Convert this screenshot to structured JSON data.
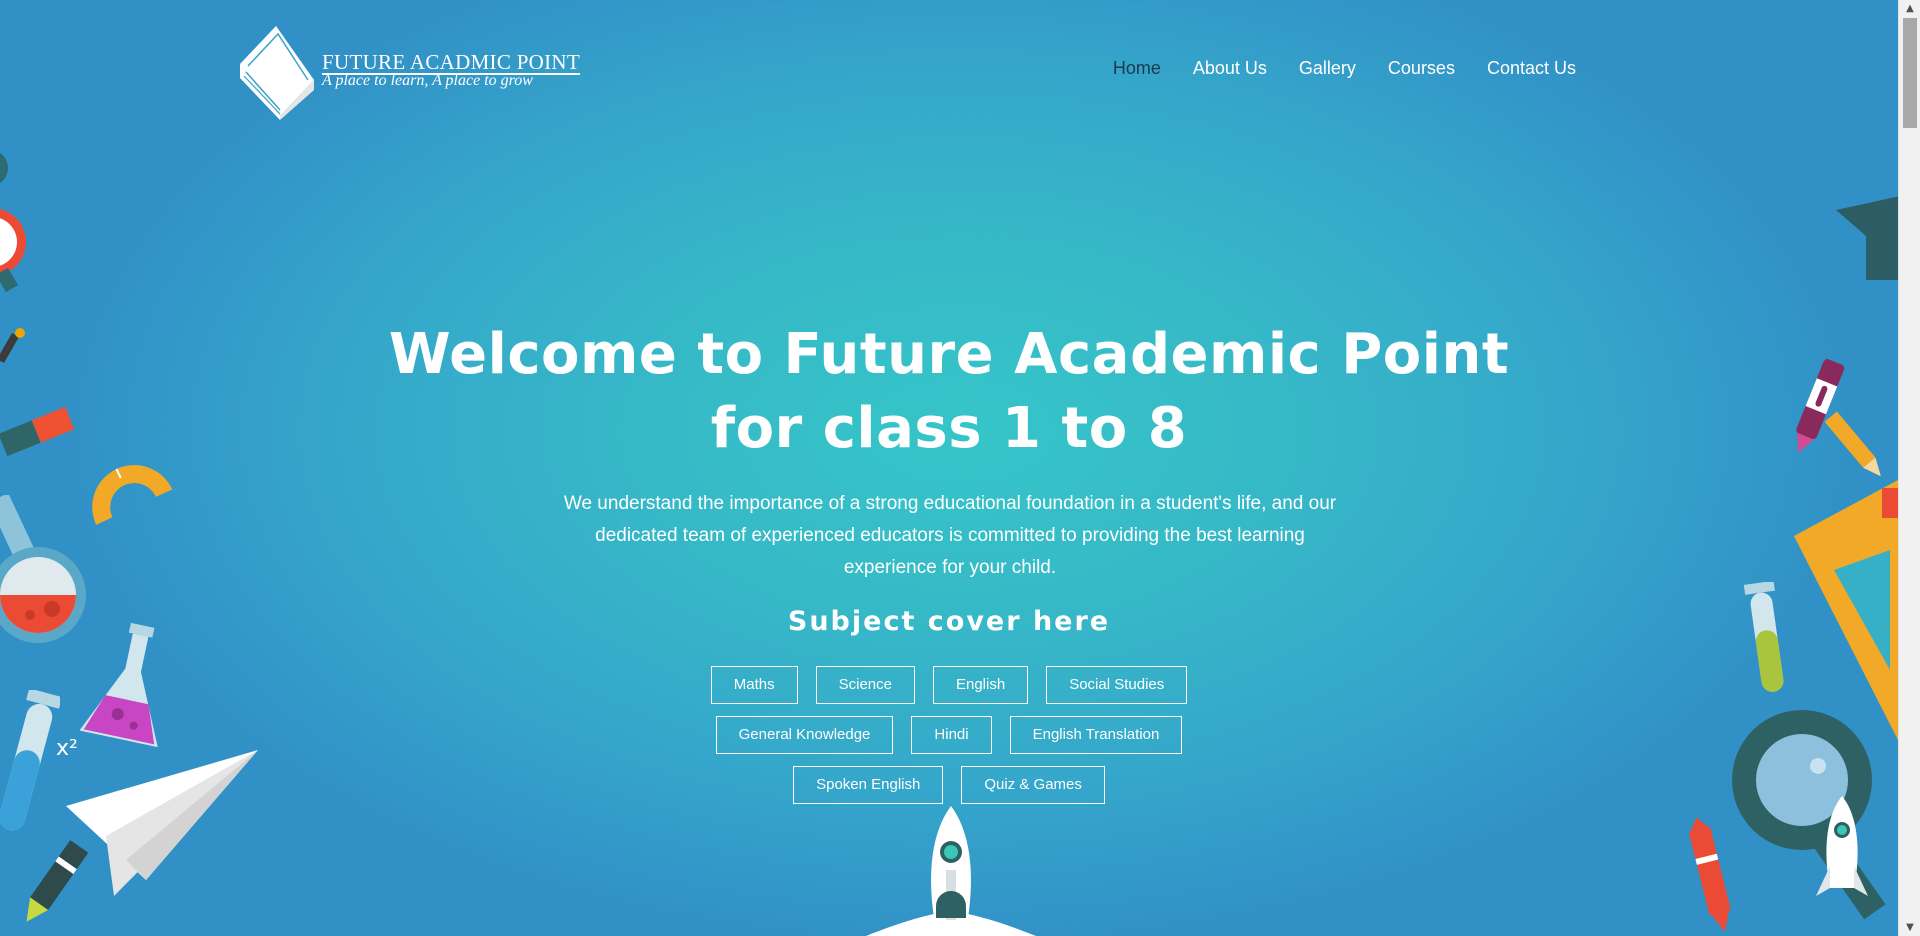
{
  "brand": {
    "name": "FUTURE ACADMIC POINT",
    "tagline": "A place to learn, A place to grow"
  },
  "nav": {
    "items": [
      {
        "label": "Home",
        "active": true
      },
      {
        "label": "About Us"
      },
      {
        "label": "Gallery"
      },
      {
        "label": "Courses"
      },
      {
        "label": "Contact Us"
      }
    ]
  },
  "hero": {
    "title_line1": "Welcome to Future Academic Point",
    "title_line2": "for class 1 to 8",
    "description": "We understand the importance of a strong educational foundation in a student's life, and our dedicated team of experienced educators is committed to providing the best learning experience for your child.",
    "subjects_heading": "Subject cover here",
    "subjects": [
      "Maths",
      "Science",
      "English",
      "Social Studies",
      "General Knowledge",
      "Hindi",
      "English Translation",
      "Spoken English",
      "Quiz & Games"
    ]
  },
  "colors": {
    "background_center": "#35c5c8",
    "background_edge": "#3190c6",
    "active_nav": "#1d3a4a"
  },
  "decor": {
    "math_label": "x²"
  }
}
